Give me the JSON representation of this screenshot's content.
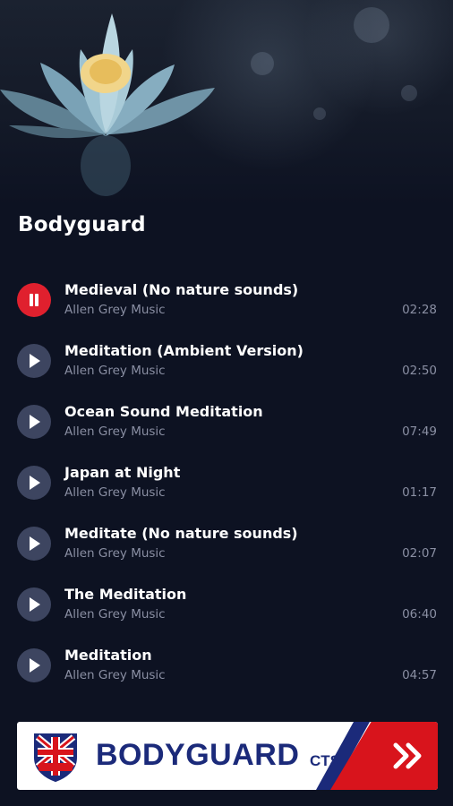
{
  "playlist": {
    "title": "Bodyguard"
  },
  "tracks": [
    {
      "title": "Medieval (No nature sounds)",
      "artist": "Allen Grey Music",
      "duration": "02:28",
      "state": "playing"
    },
    {
      "title": "Meditation (Ambient Version)",
      "artist": "Allen Grey Music",
      "duration": "02:50",
      "state": "paused"
    },
    {
      "title": "Ocean Sound Meditation",
      "artist": "Allen Grey Music",
      "duration": "07:49",
      "state": "paused"
    },
    {
      "title": "Japan at Night",
      "artist": "Allen Grey Music",
      "duration": "01:17",
      "state": "paused"
    },
    {
      "title": "Meditate (No nature sounds)",
      "artist": "Allen Grey Music",
      "duration": "02:07",
      "state": "paused"
    },
    {
      "title": "The Meditation",
      "artist": "Allen Grey Music",
      "duration": "06:40",
      "state": "paused"
    },
    {
      "title": "Meditation",
      "artist": "Allen Grey Music",
      "duration": "04:57",
      "state": "paused"
    }
  ],
  "banner": {
    "brand_text": "BODYGUARD",
    "suffix_text": "CTS",
    "logo_text": "BODYGUARD"
  },
  "icons": {
    "playing": "pause-icon",
    "paused": "play-icon",
    "banner_arrow": "double-chevron-right-icon",
    "banner_logo": "union-jack-shield-icon"
  },
  "colors": {
    "background": "#0d1222",
    "active_button": "#e0202e",
    "button": "#3d4560",
    "secondary_text": "#8a8fa3",
    "banner_navy": "#1b2a7a",
    "banner_red": "#d8141c"
  }
}
